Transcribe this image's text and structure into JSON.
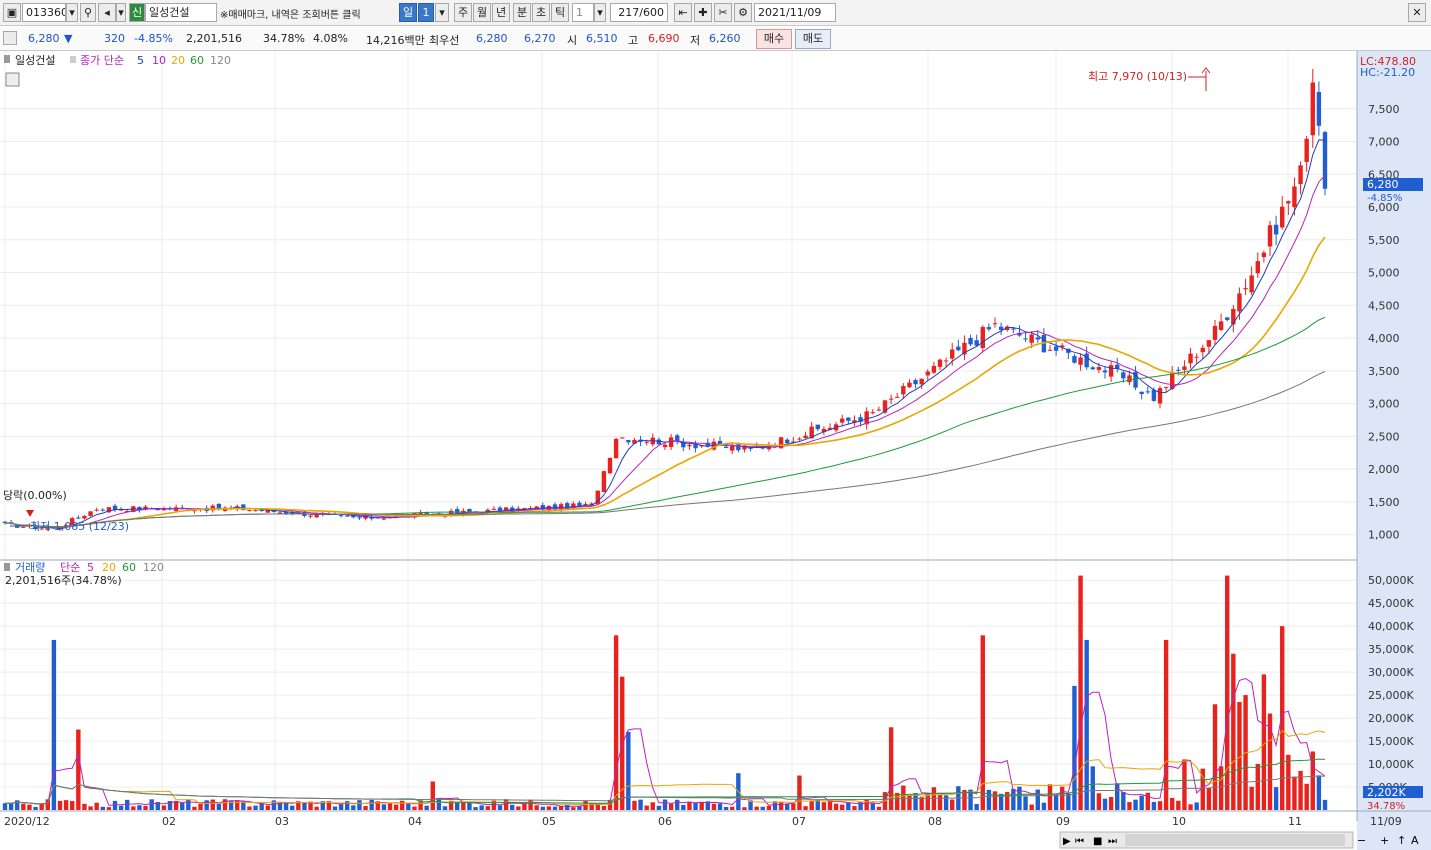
{
  "toolbar": {
    "code": "013360",
    "credit_badge": "신",
    "stock_name": "일성건설",
    "hint": "※매매마크, 내역은 조회버튼 클릭",
    "periods": [
      "일",
      "1",
      "주",
      "월",
      "년",
      "분",
      "초",
      "틱"
    ],
    "tick_value": "1",
    "count": "217",
    "count_total": "/600",
    "date": "2021/11/09"
  },
  "quote": {
    "price": "6,280",
    "direction": "▼",
    "change": "320",
    "change_pct": "-4.85%",
    "volume": "2,201,516",
    "volume_ratio": "34.78%",
    "turnover": "4.08%",
    "trade_value": "14,216백만",
    "best_label": "최우선",
    "best_ask": "6,280",
    "best_bid": "6,270",
    "open_label": "시",
    "open": "6,510",
    "high_label": "고",
    "high": "6,690",
    "low_label": "저",
    "low": "6,260",
    "buy_label": "매수",
    "sell_label": "매도"
  },
  "price_panel": {
    "title": "일성건설",
    "ma_label": "종가 단순",
    "ma_periods": [
      "5",
      "10",
      "20",
      "60",
      "120"
    ],
    "ma_colors": [
      "#1f3fbf",
      "#bb22bb",
      "#e8a600",
      "#1f9a3a",
      "#777777"
    ],
    "lc": "LC:478.80",
    "hc": "HC:-21.20",
    "high_annot": "최고 7,970 (10/13)",
    "low_annot": "최저 1,085 (12/23)",
    "limit_annot": "당락(0.00%)",
    "current_tag": "6,280",
    "current_pct": "-4.85%",
    "y_ticks": [
      "7,500",
      "7,000",
      "6,500",
      "6,000",
      "5,500",
      "5,000",
      "4,500",
      "4,000",
      "3,500",
      "3,000",
      "2,500",
      "2,000",
      "1,500",
      "1,000"
    ]
  },
  "volume_panel": {
    "title": "거래량",
    "ma_label": "단순",
    "ma_periods": [
      "5",
      "20",
      "60",
      "120"
    ],
    "current": "2,201,516주(34.78%)",
    "current_tag": "2,202K",
    "current_pct": "34.78%",
    "y_ticks": [
      "50,000K",
      "45,000K",
      "40,000K",
      "35,000K",
      "30,000K",
      "25,000K",
      "20,000K",
      "15,000K",
      "10,000K",
      "5,000K"
    ]
  },
  "x_axis": {
    "labels": [
      "2020/12",
      "02",
      "03",
      "04",
      "05",
      "06",
      "07",
      "08",
      "09",
      "10",
      "11",
      "11/09"
    ]
  },
  "colors": {
    "up": "#e8221d",
    "down": "#1f5fd1",
    "accent": "#3a78c7"
  },
  "chart_data": {
    "type": "candlestick",
    "close_anchors": [
      {
        "date": "2020/12",
        "close": 1150
      },
      {
        "date": "2020/12/23",
        "close": 1085
      },
      {
        "date": "2021/01",
        "close": 1400
      },
      {
        "date": "2021/02",
        "close": 1400
      },
      {
        "date": "2021/03",
        "close": 1250
      },
      {
        "date": "2021/04",
        "close": 1450
      },
      {
        "date": "2021/04",
        "close": 2500
      },
      {
        "date": "2021/05",
        "close": 2300
      },
      {
        "date": "2021/06",
        "close": 2850
      },
      {
        "date": "2021/07",
        "close": 4200
      },
      {
        "date": "2021/08",
        "close": 3450
      },
      {
        "date": "2021/08",
        "close": 3100
      },
      {
        "date": "2021/09",
        "close": 4100
      },
      {
        "date": "2021/09",
        "close": 5000
      },
      {
        "date": "2021/10",
        "close": 6500
      },
      {
        "date": "2021/10/13",
        "close": 7970
      },
      {
        "date": "2021/11",
        "close": 6800
      },
      {
        "date": "2021/11/09",
        "close": 6280
      }
    ],
    "volume_peaks_k": [
      {
        "date": "2020/12",
        "volume": 37000
      },
      {
        "date": "2021/04",
        "volume": 38000
      },
      {
        "date": "2021/06",
        "volume": 38000
      },
      {
        "date": "2021/07",
        "volume": 51000
      },
      {
        "date": "2021/07",
        "volume": 37000
      },
      {
        "date": "2021/09",
        "volume": 51000
      },
      {
        "date": "2021/10",
        "volume": 40000
      }
    ],
    "ylim_price": [
      750,
      8000
    ],
    "ylim_volume_k": [
      0,
      52000
    ]
  }
}
